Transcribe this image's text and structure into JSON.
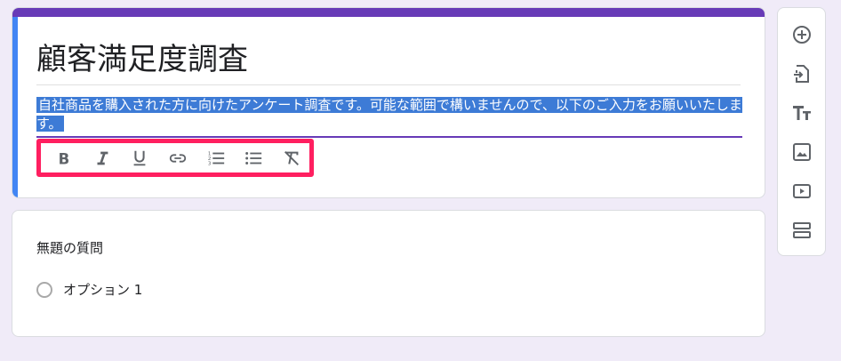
{
  "form": {
    "title": "顧客満足度調査",
    "description": "自社商品を購入された方に向けたアンケート調査です。可能な範囲で構いませんので、以下のご入力をお願いいたします。"
  },
  "format_toolbar": {
    "buttons": [
      "bold-icon",
      "italic-icon",
      "underline-icon",
      "link-icon",
      "numbered-list-icon",
      "bulleted-list-icon",
      "clear-format-icon"
    ]
  },
  "question": {
    "title": "無題の質問",
    "options": [
      "オプション 1"
    ]
  },
  "side_toolbar": {
    "buttons": [
      "add-question-icon",
      "import-questions-icon",
      "add-title-icon",
      "add-image-icon",
      "add-video-icon",
      "add-section-icon"
    ]
  },
  "colors": {
    "accent": "#673ab7",
    "selection": "#3d7bd6",
    "highlight_box": "#ff1f60",
    "background": "#f0ebf8"
  }
}
